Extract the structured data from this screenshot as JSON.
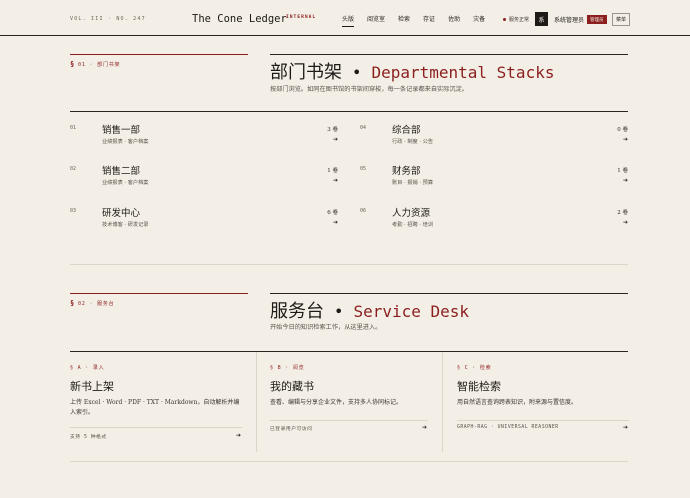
{
  "header": {
    "vol": "VOL. III · NO. 247",
    "brand": "The Cone Ledger",
    "brand_tag": "INTERNAL",
    "nav": [
      "头版",
      "阅览室",
      "检索",
      "存证",
      "佐助",
      "灾备"
    ],
    "status": "服务正常",
    "avatar": "系",
    "username": "系统管理员",
    "role": "管理员",
    "menu": "菜单",
    "accent_color": "#8b1e1e"
  },
  "departments_section": {
    "label": "01 · 部门书架",
    "title_zh": "部门书架",
    "title_en": "Departmental Stacks",
    "desc": "按部门浏览。如同在图书馆的书架间穿梭，每一条记录都来自实际沉淀。",
    "items": [
      {
        "num": "01",
        "name": "销售一部",
        "sub": "业绩报表 · 客户档案",
        "count": "3 卷"
      },
      {
        "num": "02",
        "name": "销售二部",
        "sub": "业绩报表 · 客户档案",
        "count": "1 卷"
      },
      {
        "num": "03",
        "name": "研发中心",
        "sub": "技术博客 · 研发记录",
        "count": "6 卷"
      },
      {
        "num": "04",
        "name": "综合部",
        "sub": "行政 · 制度 · 公告",
        "count": "0 卷"
      },
      {
        "num": "05",
        "name": "财务部",
        "sub": "账目 · 报销 · 预算",
        "count": "1 卷"
      },
      {
        "num": "06",
        "name": "人力资源",
        "sub": "考勤 · 招聘 · 培训",
        "count": "2 卷"
      }
    ],
    "arrow": "➔"
  },
  "service_section": {
    "label": "02 · 服务台",
    "title_zh": "服务台",
    "title_en": "Service Desk",
    "desc": "开始今日的知识检索工作，从这里进入。",
    "cards": [
      {
        "label": "§ A · 录入",
        "title": "新书上架",
        "desc": "上传 Excel · Word · PDF · TXT · Markdown，自动解析并编入索引。",
        "foot": "支持 5 种格式"
      },
      {
        "label": "§ B · 阅览",
        "title": "我的藏书",
        "desc": "查看、编辑与分享企业文件，支持多人协同标记。",
        "foot": "已登录用户可访问"
      },
      {
        "label": "§ C · 检索",
        "title": "智能检索",
        "desc": "用自然语言查询跨表知识，附来源与置信度。",
        "foot": "GRAPH-RAG · UNIVERSAL REASONER"
      }
    ],
    "arrow": "➔"
  }
}
